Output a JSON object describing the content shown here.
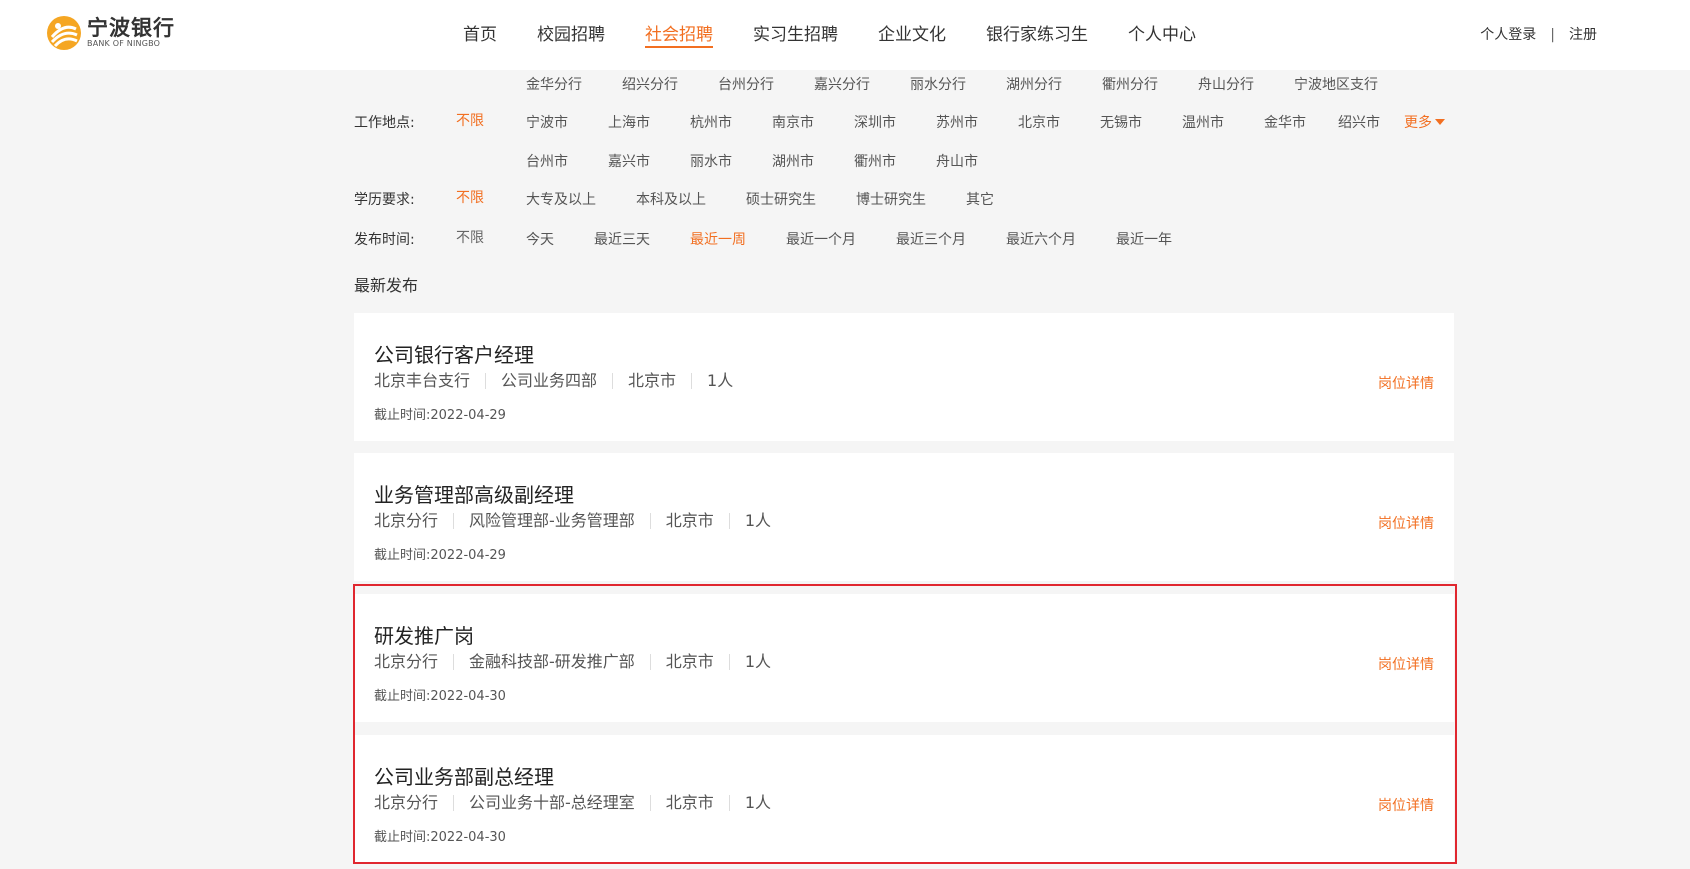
{
  "brand": {
    "name_cn": "宁波银行",
    "name_en": "BANK OF NINGBO",
    "accent": "#f26f21"
  },
  "nav": [
    {
      "label": "首页",
      "active": false
    },
    {
      "label": "校园招聘",
      "active": false
    },
    {
      "label": "社会招聘",
      "active": true
    },
    {
      "label": "实习生招聘",
      "active": false
    },
    {
      "label": "企业文化",
      "active": false
    },
    {
      "label": "银行家练习生",
      "active": false
    },
    {
      "label": "个人中心",
      "active": false
    }
  ],
  "user": {
    "login": "个人登录",
    "separator": "|",
    "register": "注册"
  },
  "filters": {
    "location": {
      "label": "工作地点:",
      "all": "不限",
      "branches": [
        "金华分行",
        "绍兴分行",
        "台州分行",
        "嘉兴分行",
        "丽水分行",
        "湖州分行",
        "衢州分行",
        "舟山分行",
        "宁波地区支行"
      ],
      "cities_row1": [
        "宁波市",
        "上海市",
        "杭州市",
        "南京市",
        "深圳市",
        "苏州市",
        "北京市",
        "无锡市",
        "温州市",
        "金华市",
        "绍兴市"
      ],
      "more": "更多",
      "cities_row2": [
        "台州市",
        "嘉兴市",
        "丽水市",
        "湖州市",
        "衢州市",
        "舟山市"
      ]
    },
    "education": {
      "label": "学历要求:",
      "all": "不限",
      "options": [
        "大专及以上",
        "本科及以上",
        "硕士研究生",
        "博士研究生",
        "其它"
      ]
    },
    "time": {
      "label": "发布时间:",
      "all": "不限",
      "options": [
        "今天",
        "最近三天",
        "最近一周",
        "最近一个月",
        "最近三个月",
        "最近六个月",
        "最近一年"
      ],
      "selected": "最近一周"
    }
  },
  "section_title": "最新发布",
  "deadline_label": "截止时间:",
  "detail_label": "岗位详情",
  "jobs": [
    {
      "title": "公司银行客户经理",
      "branch": "北京丰台支行",
      "dept": "公司业务四部",
      "city": "北京市",
      "count": "1人",
      "deadline": "2022-04-29"
    },
    {
      "title": "业务管理部高级副经理",
      "branch": "北京分行",
      "dept": "风险管理部-业务管理部",
      "city": "北京市",
      "count": "1人",
      "deadline": "2022-04-29"
    },
    {
      "title": "研发推广岗",
      "branch": "北京分行",
      "dept": "金融科技部-研发推广部",
      "city": "北京市",
      "count": "1人",
      "deadline": "2022-04-30"
    },
    {
      "title": "公司业务部副总经理",
      "branch": "北京分行",
      "dept": "公司业务十部-总经理室",
      "city": "北京市",
      "count": "1人",
      "deadline": "2022-04-30"
    }
  ]
}
